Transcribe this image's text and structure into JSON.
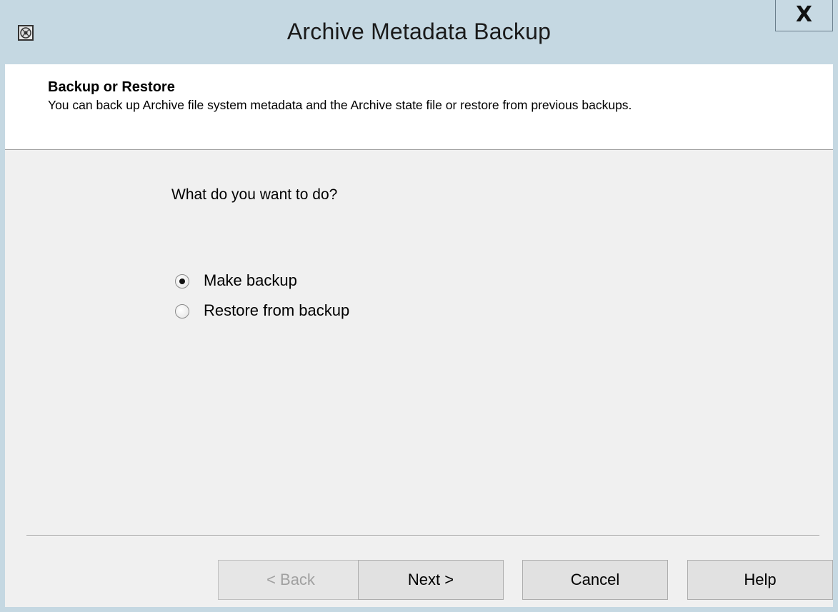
{
  "window": {
    "title": "Archive Metadata Backup",
    "close_label": "X"
  },
  "header": {
    "title": "Backup or Restore",
    "description": "You can back up Archive file system metadata and the Archive state file or restore from previous backups."
  },
  "main": {
    "prompt": "What do you want to do?",
    "options": [
      {
        "label": "Make backup",
        "selected": true
      },
      {
        "label": "Restore from backup",
        "selected": false
      }
    ]
  },
  "buttons": {
    "back": "< Back",
    "next": "Next >",
    "cancel": "Cancel",
    "help": "Help"
  },
  "colors": {
    "titlebar": "#c5d8e2",
    "content_bg": "#f0f0f0",
    "header_bg": "#ffffff"
  }
}
